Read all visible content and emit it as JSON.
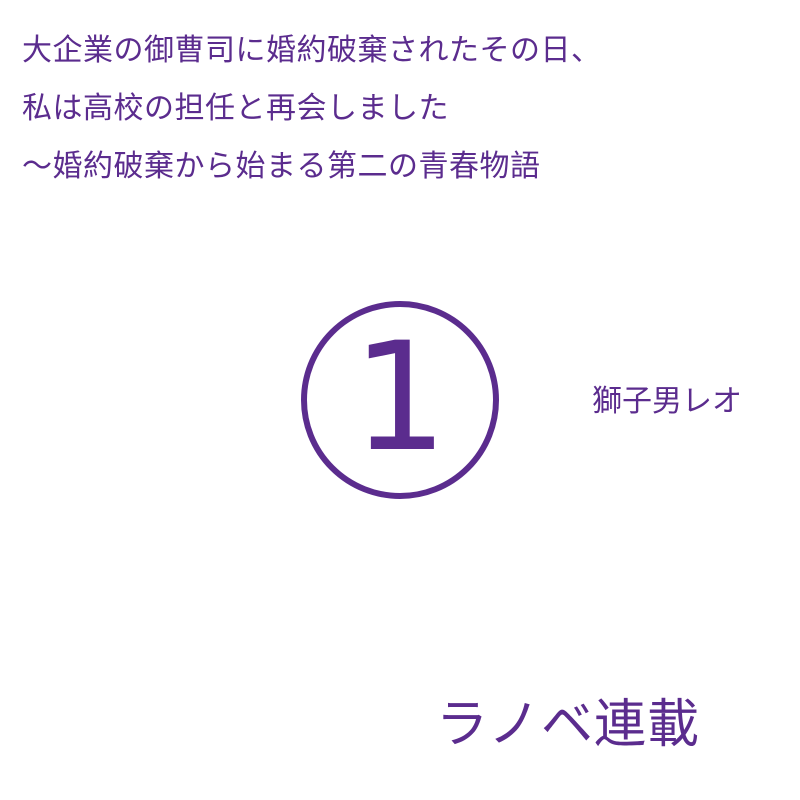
{
  "title": {
    "lines": [
      "大企業の御曹司に婚約破棄されたその日、",
      "私は高校の担任と再会しました",
      "〜婚約破棄から始まる第二の青春物語"
    ]
  },
  "volume": {
    "number": "1"
  },
  "author": {
    "name": "獅子男レオ"
  },
  "series": {
    "label": "ラノベ連載"
  },
  "colors": {
    "text": "#5b2c8e",
    "background": "#ffffff"
  }
}
